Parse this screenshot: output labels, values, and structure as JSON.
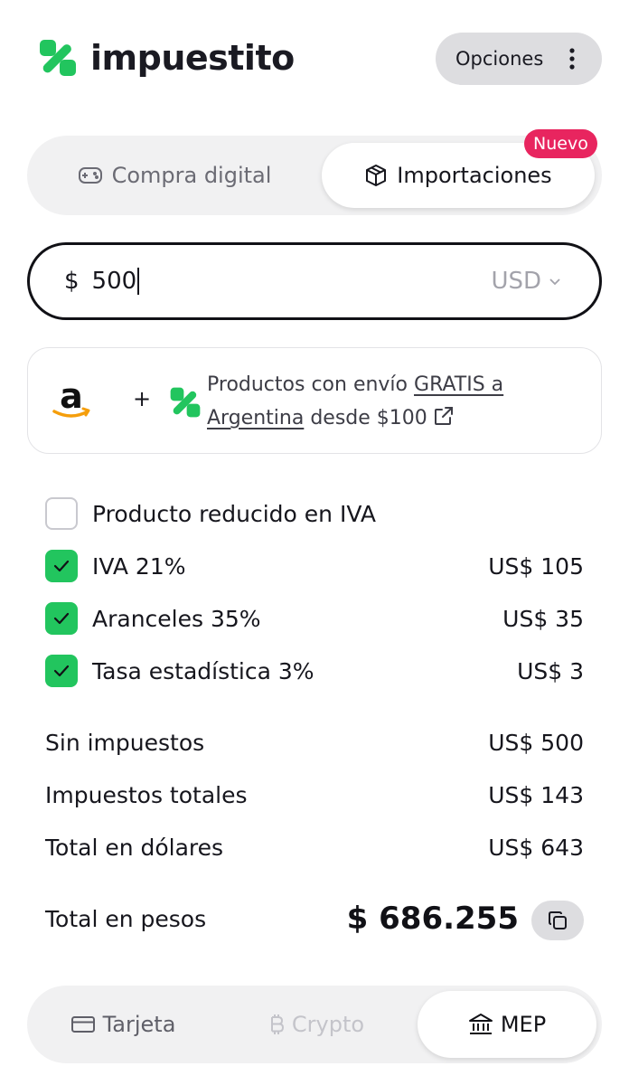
{
  "header": {
    "brand": "impuestito",
    "options_label": "Opciones"
  },
  "tabs": {
    "digital_label": "Compra digital",
    "import_label": "Importaciones",
    "new_badge": "Nuevo",
    "active": "Importaciones"
  },
  "amount": {
    "currency_symbol": "$",
    "value": "500",
    "currency": "USD"
  },
  "promo": {
    "plus": "+",
    "text_before": "Productos con envío ",
    "link_text": "GRATIS a Argentina",
    "text_after": " desde $100"
  },
  "breakdown": {
    "reduced_label": "Producto reducido en IVA",
    "reduced_checked": false,
    "items": [
      {
        "label": "IVA 21%",
        "amount": "US$ 105",
        "checked": true
      },
      {
        "label": "Aranceles 35%",
        "amount": "US$ 35",
        "checked": true
      },
      {
        "label": "Tasa estadística 3%",
        "amount": "US$ 3",
        "checked": true
      }
    ]
  },
  "totals": {
    "sin_label": "Sin impuestos",
    "sin_value": "US$ 500",
    "impuestos_label": "Impuestos totales",
    "impuestos_value": "US$ 143",
    "dolares_label": "Total en dólares",
    "dolares_value": "US$ 643",
    "pesos_label": "Total en pesos",
    "pesos_value": "$ 686.255"
  },
  "methods": {
    "card_label": "Tarjeta",
    "crypto_label": "Crypto",
    "mep_label": "MEP",
    "active": "MEP"
  },
  "colors": {
    "brand_green": "#22c55e",
    "badge_pink": "#e8255f",
    "text_dark": "#16161d",
    "pill_grey": "#dddde0"
  }
}
